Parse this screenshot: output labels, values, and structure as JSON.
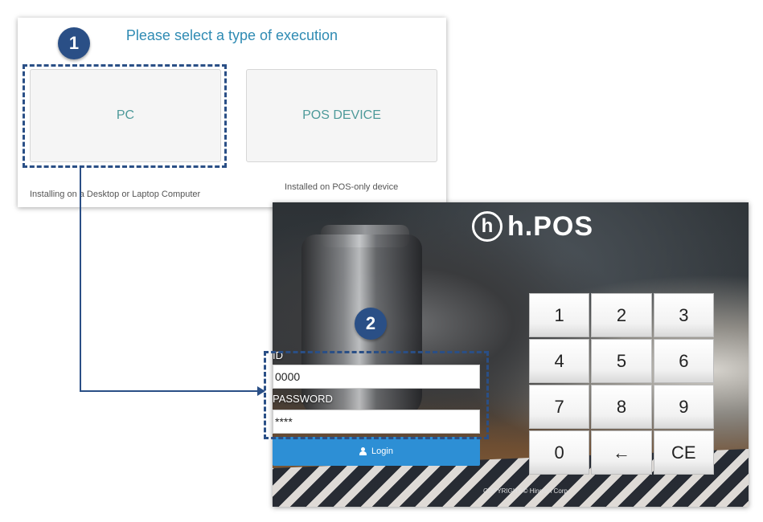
{
  "select_panel": {
    "title": "Please select a type of execution",
    "options": [
      {
        "label": "PC",
        "description": "Installing on a Desktop or Laptop Computer"
      },
      {
        "label": "POS DEVICE",
        "description": "Installed on POS-only device"
      }
    ]
  },
  "badges": [
    "1",
    "2"
  ],
  "login_panel": {
    "logo_mark": "h",
    "logo_text": "h.POS",
    "id_label": "ID",
    "id_value": "0000",
    "password_label": "PASSWORD",
    "password_value": "****",
    "login_button": "Login",
    "keypad": [
      "1",
      "2",
      "3",
      "4",
      "5",
      "6",
      "7",
      "8",
      "9",
      "0",
      "←",
      "CE"
    ],
    "copyright": "COPYRIGHT © Hingom Corp."
  },
  "colors": {
    "accent": "#2a4f86",
    "title": "#2f8bb3",
    "option_text": "#4e9a9a",
    "login_button": "#2d8fd5"
  },
  "icons": [
    "user-icon",
    "backspace-arrow-icon"
  ]
}
